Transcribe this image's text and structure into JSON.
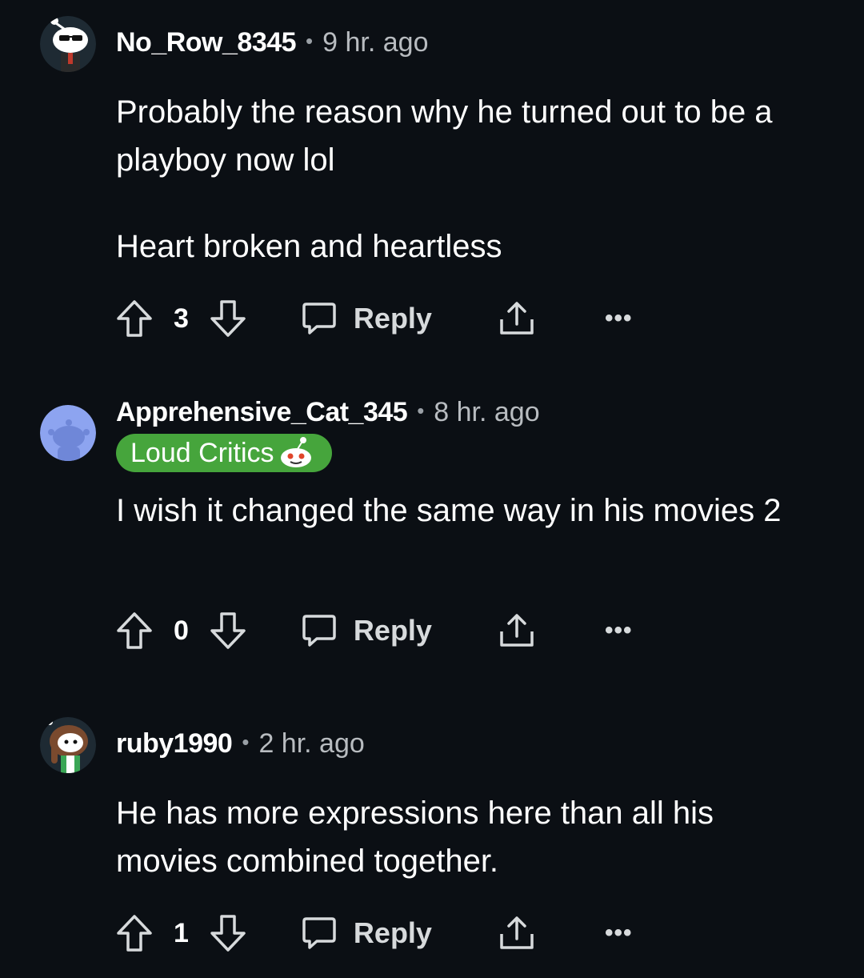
{
  "comments": [
    {
      "username": "No_Row_8345",
      "separator": "•",
      "time": "9 hr. ago",
      "avatar": "snoo-sunglasses-avatar",
      "paragraphs": [
        "Probably the reason why he turned out to be a playboy now lol",
        "Heart broken and heartless"
      ],
      "score": "3",
      "reply_label": "Reply",
      "more_label": "•••"
    },
    {
      "username": "Apprehensive_Cat_345",
      "separator": "•",
      "time": "8 hr. ago",
      "avatar": "default-snoo-avatar",
      "flair": "Loud Critics",
      "flair_color": "#46a53c",
      "paragraphs": [
        "I wish it changed the same way in his movies 2"
      ],
      "score": "0",
      "reply_label": "Reply",
      "more_label": "•••"
    },
    {
      "username": "ruby1990",
      "separator": "•",
      "time": "2 hr. ago",
      "avatar": "girl-snoo-avatar",
      "paragraphs": [
        "He has more expressions here than all his movies combined together."
      ],
      "score": "1",
      "reply_label": "Reply",
      "more_label": "•••"
    }
  ],
  "colors": {
    "background": "#0b0f14",
    "text": "#ffffff",
    "muted": "#b8bcc0",
    "flair": "#46a53c"
  }
}
